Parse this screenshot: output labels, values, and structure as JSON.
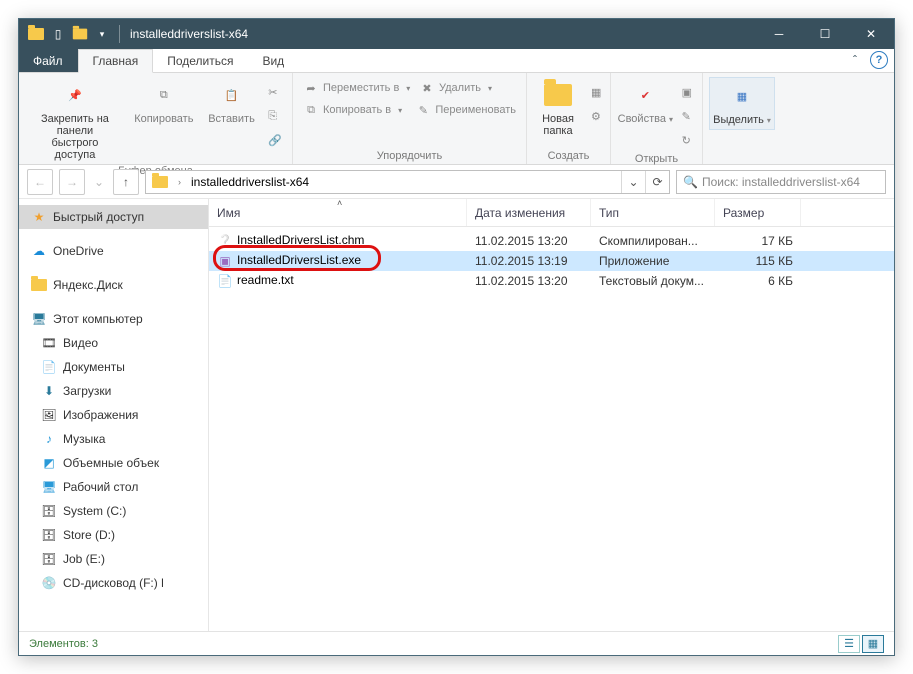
{
  "window": {
    "title": "installeddriverslist-x64"
  },
  "tabs": {
    "file": "Файл",
    "home": "Главная",
    "share": "Поделиться",
    "view": "Вид"
  },
  "ribbon": {
    "clipboard": {
      "pin": "Закрепить на панели\nбыстрого доступа",
      "copy": "Копировать",
      "paste": "Вставить",
      "label": "Буфер обмена"
    },
    "organize": {
      "move": "Переместить в",
      "copy": "Копировать в",
      "delete": "Удалить",
      "rename": "Переименовать",
      "label": "Упорядочить"
    },
    "new": {
      "folder": "Новая\nпапка",
      "label": "Создать"
    },
    "open": {
      "props": "Свойства",
      "label": "Открыть"
    },
    "select": {
      "select": "Выделить",
      "label": ""
    }
  },
  "address": {
    "path": "installeddriverslist-x64",
    "search_placeholder": "Поиск: installeddriverslist-x64"
  },
  "nav": {
    "quick": "Быстрый доступ",
    "onedrive": "OneDrive",
    "yandex": "Яндекс.Диск",
    "pc": "Этот компьютер",
    "videos": "Видео",
    "documents": "Документы",
    "downloads": "Загрузки",
    "pictures": "Изображения",
    "music": "Музыка",
    "objects": "Объемные объек",
    "desktop": "Рабочий стол",
    "c": "System (C:)",
    "d": "Store (D:)",
    "e": "Job (E:)",
    "f": "CD-дисковод (F:) l"
  },
  "columns": {
    "name": "Имя",
    "date": "Дата изменения",
    "type": "Тип",
    "size": "Размер"
  },
  "files": [
    {
      "name": "InstalledDriversList.chm",
      "date": "11.02.2015 13:20",
      "type": "Скомпилирован...",
      "size": "17 КБ",
      "icon": "chm"
    },
    {
      "name": "InstalledDriversList.exe",
      "date": "11.02.2015 13:19",
      "type": "Приложение",
      "size": "115 КБ",
      "icon": "exe",
      "selected": true
    },
    {
      "name": "readme.txt",
      "date": "11.02.2015 13:20",
      "type": "Текстовый докум...",
      "size": "6 КБ",
      "icon": "txt"
    }
  ],
  "status": {
    "count": "Элементов: 3"
  }
}
